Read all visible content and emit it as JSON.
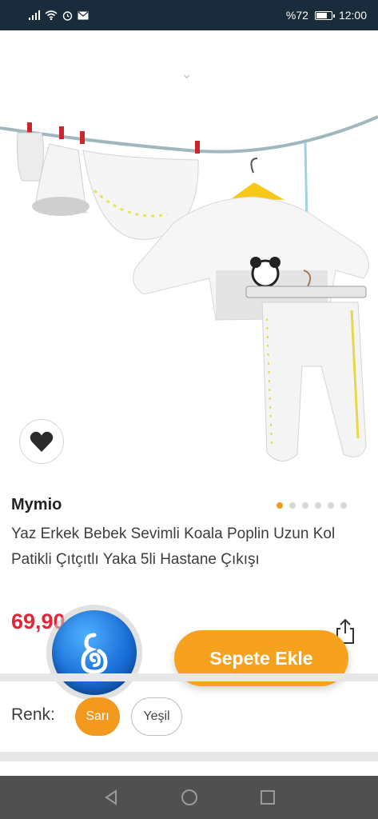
{
  "status_bar": {
    "battery_text": "%72",
    "time": "12:00",
    "battery_level": 0.72,
    "icons": [
      "signal-icon",
      "wifi-icon",
      "alarm-icon",
      "mail-icon"
    ]
  },
  "product": {
    "brand": "Mymio",
    "title": "Yaz Erkek Bebek Sevimli Koala Poplin Uzun Kol Patikli Çıtçıtlı Yaka 5li Hastane Çıkışı",
    "price": "69,90",
    "image_count": 6,
    "active_image_index": 0
  },
  "actions": {
    "add_to_cart": "Sepete Ekle"
  },
  "color_selector": {
    "label": "Renk:",
    "options": [
      {
        "label": "Sarı",
        "selected": true
      },
      {
        "label": "Yeşil",
        "selected": false
      }
    ]
  },
  "theme": {
    "accent": "#f39a1e",
    "price_color": "#e0273a",
    "status_bar_bg": "#1a2b3c"
  }
}
